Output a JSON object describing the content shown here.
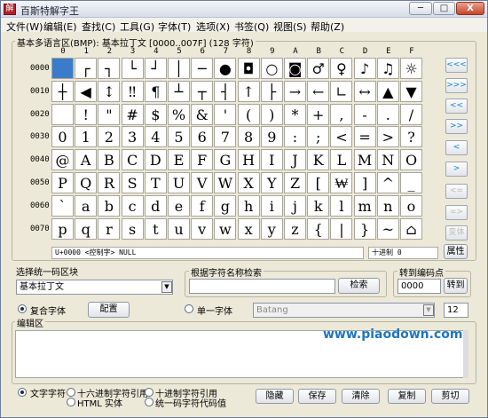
{
  "window": {
    "title": "百斯特解字王",
    "app_icon_text": "解",
    "minimize": "─",
    "maximize": "□",
    "close": "X"
  },
  "menu": [
    "文件(W)",
    "编辑(E)",
    "查找(C)",
    "工具(G)",
    "字体(T)",
    "选项(X)",
    "书签(Q)",
    "视图(S)",
    "帮助(Z)"
  ],
  "grid": {
    "label": "基本多语言区(BMP): 基本拉丁文 [0000..007F] (128 字符)",
    "col_headers": [
      "0",
      "1",
      "2",
      "3",
      "4",
      "5",
      "6",
      "7",
      "8",
      "9",
      "A",
      "B",
      "C",
      "D",
      "E",
      "F"
    ],
    "row_headers": [
      "0000",
      "0010",
      "0020",
      "0030",
      "0040",
      "0050",
      "0060",
      "0070"
    ],
    "rows": [
      [
        "",
        "┌",
        "┐",
        "└",
        "┘",
        "│",
        "─",
        "●",
        "◘",
        "○",
        "◙",
        "♂",
        "♀",
        "♪",
        "♫",
        "☼"
      ],
      [
        "┼",
        "◀",
        "↕",
        "‼",
        "¶",
        "┴",
        "┬",
        "┤",
        "↑",
        "├",
        "→",
        "←",
        "∟",
        "↔",
        "▲",
        "▼"
      ],
      [
        "",
        "!",
        "\"",
        "#",
        "$",
        "%",
        "&",
        "'",
        "(",
        ")",
        "*",
        "+",
        ",",
        "-",
        ".",
        "/"
      ],
      [
        "0",
        "1",
        "2",
        "3",
        "4",
        "5",
        "6",
        "7",
        "8",
        "9",
        ":",
        ";",
        "<",
        "=",
        ">",
        "?"
      ],
      [
        "@",
        "A",
        "B",
        "C",
        "D",
        "E",
        "F",
        "G",
        "H",
        "I",
        "J",
        "K",
        "L",
        "M",
        "N",
        "O"
      ],
      [
        "P",
        "Q",
        "R",
        "S",
        "T",
        "U",
        "V",
        "W",
        "X",
        "Y",
        "Z",
        "[",
        "₩",
        "]",
        "^",
        "_"
      ],
      [
        "`",
        "a",
        "b",
        "c",
        "d",
        "e",
        "f",
        "g",
        "h",
        "i",
        "j",
        "k",
        "l",
        "m",
        "n",
        "o"
      ],
      [
        "p",
        "q",
        "r",
        "s",
        "t",
        "u",
        "v",
        "w",
        "x",
        "y",
        "z",
        "{",
        "|",
        "}",
        "~",
        "⌂"
      ]
    ],
    "selected_char_info": "U+0000 <控制字> NULL",
    "decimal_label": "十进制 0"
  },
  "nav": {
    "buttons": [
      "<<<",
      ">>>",
      "<<",
      ">>",
      "<",
      ">",
      "<=",
      "=>",
      "变体"
    ],
    "attr_button": "属性"
  },
  "block_select": {
    "label": "选择统一码区块",
    "value": "基本拉丁文"
  },
  "name_search": {
    "label": "根据字符名称检索",
    "value": "",
    "button": "检索"
  },
  "goto_code": {
    "label": "转到编码点",
    "value": "0000",
    "button": "转到"
  },
  "font_mode": {
    "composite_label": "复合字体",
    "config_button": "配置",
    "single_label": "单一字体",
    "font_value": "Batang",
    "size_value": "12"
  },
  "editor": {
    "label": "编辑区",
    "content": ""
  },
  "watermark": "www.piaodown.com",
  "bottom": {
    "radios": [
      "文字字符",
      "十六进制字符引用",
      "十进制字符引用",
      "HTML 实体",
      "统一码字符代码值"
    ],
    "buttons": [
      "隐藏",
      "保存",
      "清除",
      "复制",
      "剪切"
    ]
  }
}
